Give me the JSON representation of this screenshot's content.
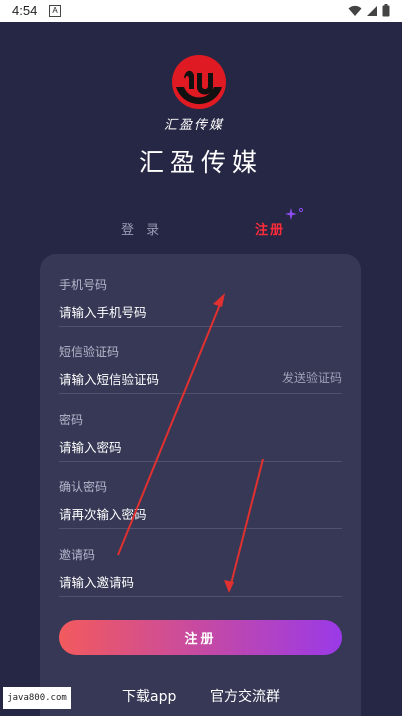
{
  "status_bar": {
    "time": "4:54",
    "notification_icon": "A"
  },
  "brand": {
    "logo_text": "汇盈传媒",
    "title": "汇盈传媒"
  },
  "tabs": {
    "login": "登 录",
    "register": "注册"
  },
  "form": {
    "phone": {
      "label": "手机号码",
      "placeholder": "请输入手机号码"
    },
    "sms_code": {
      "label": "短信验证码",
      "placeholder": "请输入短信验证码",
      "send_label": "发送验证码"
    },
    "password": {
      "label": "密码",
      "placeholder": "请输入密码"
    },
    "confirm_password": {
      "label": "确认密码",
      "placeholder": "请再次输入密码"
    },
    "invite_code": {
      "label": "邀请码",
      "placeholder": "请输入邀请码"
    },
    "submit_label": "注册"
  },
  "links": {
    "download": "下载app",
    "community": "官方交流群"
  },
  "watermark": "java800.com",
  "colors": {
    "background": "#262744",
    "card": "#363855",
    "accent_red": "#ff2a3a",
    "button_start": "#f25a5d",
    "button_end": "#9a3ae8",
    "arrow": "#e03030"
  }
}
